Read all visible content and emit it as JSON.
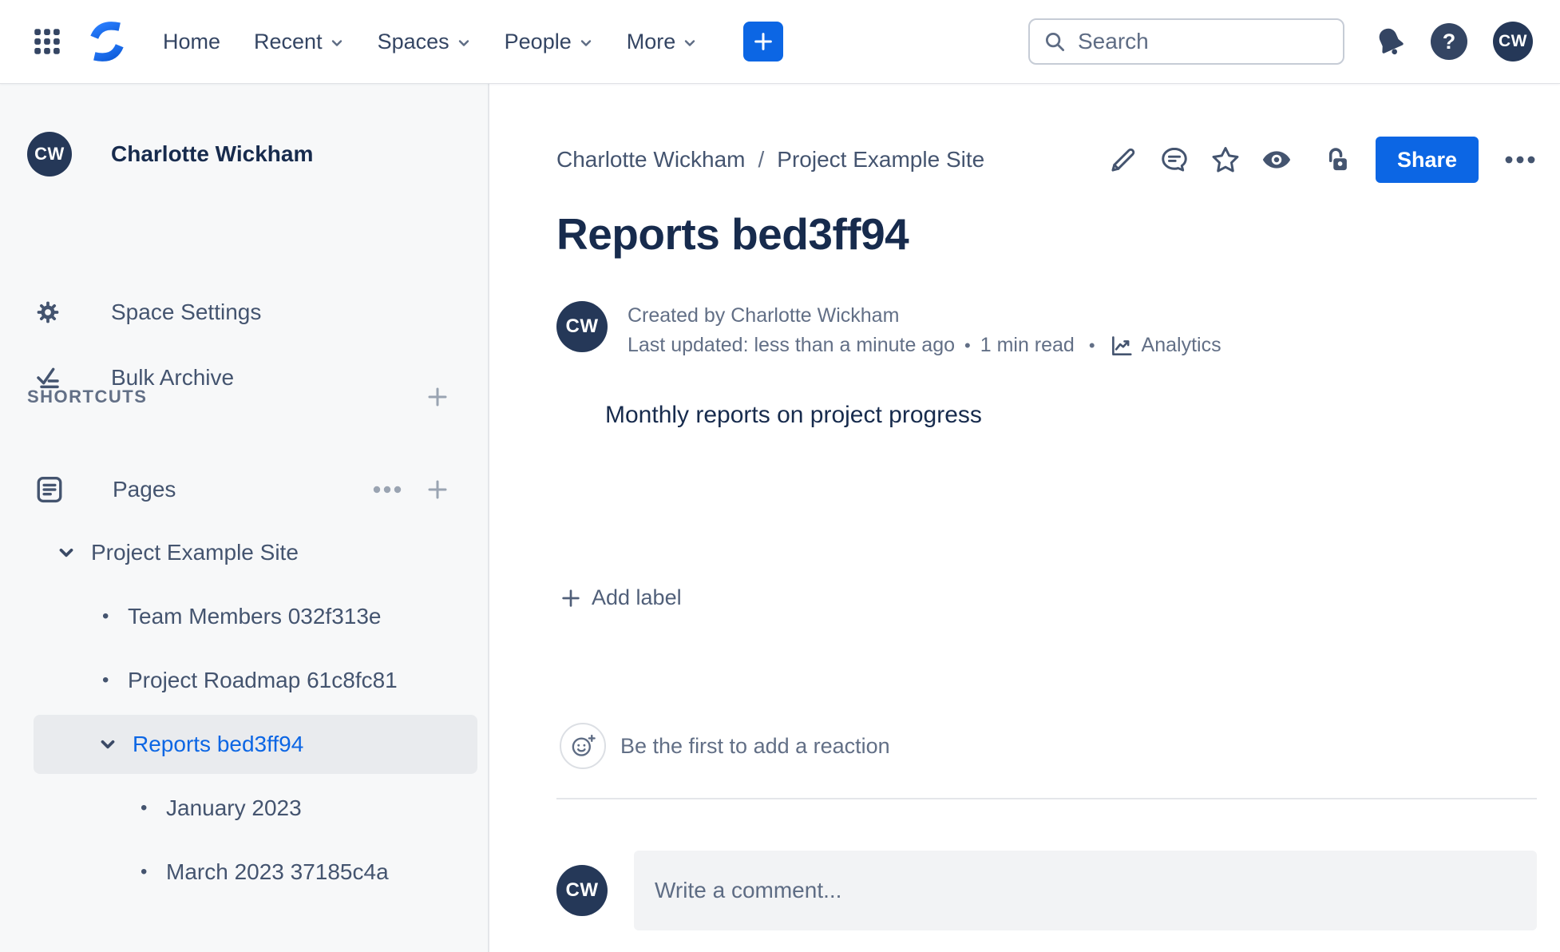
{
  "user": {
    "initials": "CW",
    "name": "Charlotte Wickham"
  },
  "navbar": {
    "links": [
      {
        "label": "Home"
      },
      {
        "label": "Recent"
      },
      {
        "label": "Spaces"
      },
      {
        "label": "People"
      },
      {
        "label": "More"
      }
    ],
    "search_placeholder": "Search",
    "help_glyph": "?"
  },
  "sidebar": {
    "space_name": "Charlotte Wickham",
    "items": [
      {
        "label": "Space Settings"
      },
      {
        "label": "Bulk Archive"
      }
    ],
    "shortcuts_label": "SHORTCUTS",
    "pages_label": "Pages",
    "bullet": "•",
    "tree": [
      {
        "label": "Project Example Site"
      },
      {
        "label": "Team Members 032f313e"
      },
      {
        "label": "Project Roadmap 61c8fc81"
      },
      {
        "label": "Reports bed3ff94"
      },
      {
        "label": "January 2023"
      },
      {
        "label": "March 2023 37185c4a"
      }
    ]
  },
  "main": {
    "breadcrumb": {
      "items": [
        "Charlotte Wickham",
        "Project Example Site"
      ],
      "separator": "/"
    },
    "share_label": "Share",
    "title": "Reports bed3ff94",
    "byline": {
      "created": "Created by Charlotte Wickham",
      "updated": "Last updated: less than a minute ago",
      "dot": "•",
      "read_time": "1 min read",
      "analytics_label": "Analytics"
    },
    "body_text": "Monthly reports on project progress",
    "add_label": "Add label",
    "reaction_prompt": "Be the first to add a reaction",
    "comment_placeholder": "Write a comment..."
  },
  "colors": {
    "accent": "#0C66E4",
    "heading": "#172B4D",
    "icon": "#44546F",
    "muted": "#626F86"
  }
}
